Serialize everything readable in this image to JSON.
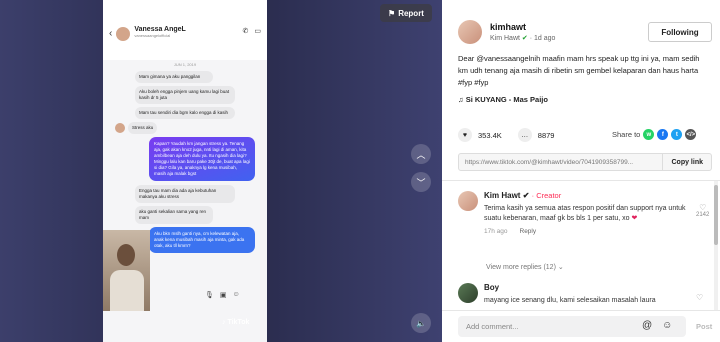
{
  "video": {
    "report_label": "Report",
    "tiktok_label": "TikTok",
    "chat": {
      "name": "Vanessa AngeL",
      "subname": "vanessaangelofficial",
      "date": "JUN 1, 2019",
      "messages": [
        {
          "dir": "in",
          "avatar": false,
          "text": "Mam gimana ya aku panggilan"
        },
        {
          "dir": "in",
          "avatar": false,
          "text": "Aku boleh engga pinjem uang kamu lagi buat kasih dr 5 juta"
        },
        {
          "dir": "in",
          "avatar": false,
          "text": "Mam tau sendiri dia bgm kalo engga di kasih"
        },
        {
          "dir": "in",
          "avatar": true,
          "text": "Stress aku"
        },
        {
          "dir": "out",
          "text": "Kapan? Yaudah km jangan stress ya. Tenang aja, gak akan kno2 juga, nnti lagi di aman, kita ambilbean aja deh dulu ya. Itu ngasih dia lagi? Minggu lalu kan baru pake 30jt de, buat apa lagi si dia? Gila ya, anaknya lg kena musibah, masih aja malak bgst"
        },
        {
          "dir": "in",
          "avatar": false,
          "text": "Engga tau mam dia ada aja kebutuhan makanya aku stress"
        },
        {
          "dir": "in",
          "avatar": false,
          "text": "aku ganti sekalian sama yang ren mam"
        },
        {
          "dir": "out-blue",
          "text": "Aku bkn mslh ganti nya, cm kelewatan aja, anak kena musibah masih aja minta, gak ada otak, aku tll kmrn?"
        }
      ]
    }
  },
  "panel": {
    "author": {
      "username": "kimhawt",
      "display_name": "Kim Hawt",
      "time": "· 1d ago"
    },
    "follow_label": "Following",
    "caption": "Dear @vanessaangelnih maafin mam hrs speak up ttg ini ya, mam sedih km udh tenang aja masih di ribetin sm gembel kelaparan dan haus harta #fyp #fyp",
    "music": "Si KUYANG - Mas Paijo",
    "likes": "353.4K",
    "comments_count": "8879",
    "share_label": "Share to",
    "link_url": "https://www.tiktok.com/@kimhawt/video/7041909358799...",
    "copy_label": "Copy link",
    "comments": [
      {
        "name": "Kim Hawt",
        "badge": "· Creator",
        "text": "Terima kasih ya semua atas respon positif dan support nya untuk suatu kebenaran, maaf gk bs bls 1 per satu, xo",
        "time": "17h ago",
        "reply": "Reply",
        "likes": "2142"
      },
      {
        "name": "Boy",
        "text": "mayang ice senang dlu, kami selesaikan masalah laura"
      }
    ],
    "view_more": "View more replies (12)",
    "add_comment_placeholder": "Add comment...",
    "post_label": "Post"
  }
}
